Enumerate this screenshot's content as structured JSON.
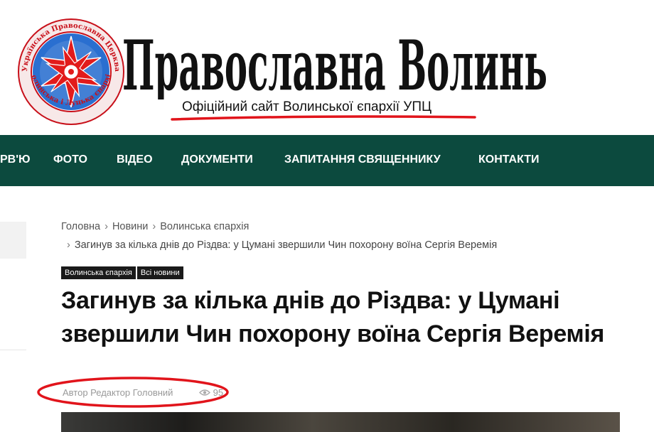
{
  "header": {
    "site_name": "Православна Волинь",
    "tagline": "Офіційний сайт Волинської єпархії УПЦ",
    "emblem_ring_text_top": "Українська Православна Церква",
    "emblem_ring_text_bottom": "Волинська і Луцька єпархія",
    "emblem_icon": "eight-pointed-star-emblem-icon",
    "highlight_color": "#e1141b"
  },
  "nav": {
    "background_color": "#0c4a3e",
    "items": [
      {
        "label": "РВ'Ю"
      },
      {
        "label": "ФОТО"
      },
      {
        "label": "ВІДЕО"
      },
      {
        "label": "ДОКУМЕНТИ"
      },
      {
        "label": "ЗАПИТАННЯ СВЯЩЕННИКУ"
      },
      {
        "label": "КОНТАКТИ"
      }
    ]
  },
  "breadcrumb": {
    "items": [
      "Головна",
      "Новини",
      "Волинська єпархія"
    ],
    "current": "Загинув за кілька днів до Різдва: у Цумані звершили Чин похорону воїна Сергія Веремія",
    "separator": "›"
  },
  "tags": [
    "Волинська єпархія",
    "Всі новини"
  ],
  "article": {
    "title": "Загинув за кілька днів до Різдва: у Цумані звершили Чин похорону воїна Сергія Веремія",
    "author": "Автор Редактор Головний",
    "views": "95",
    "views_icon": "eye-icon"
  }
}
